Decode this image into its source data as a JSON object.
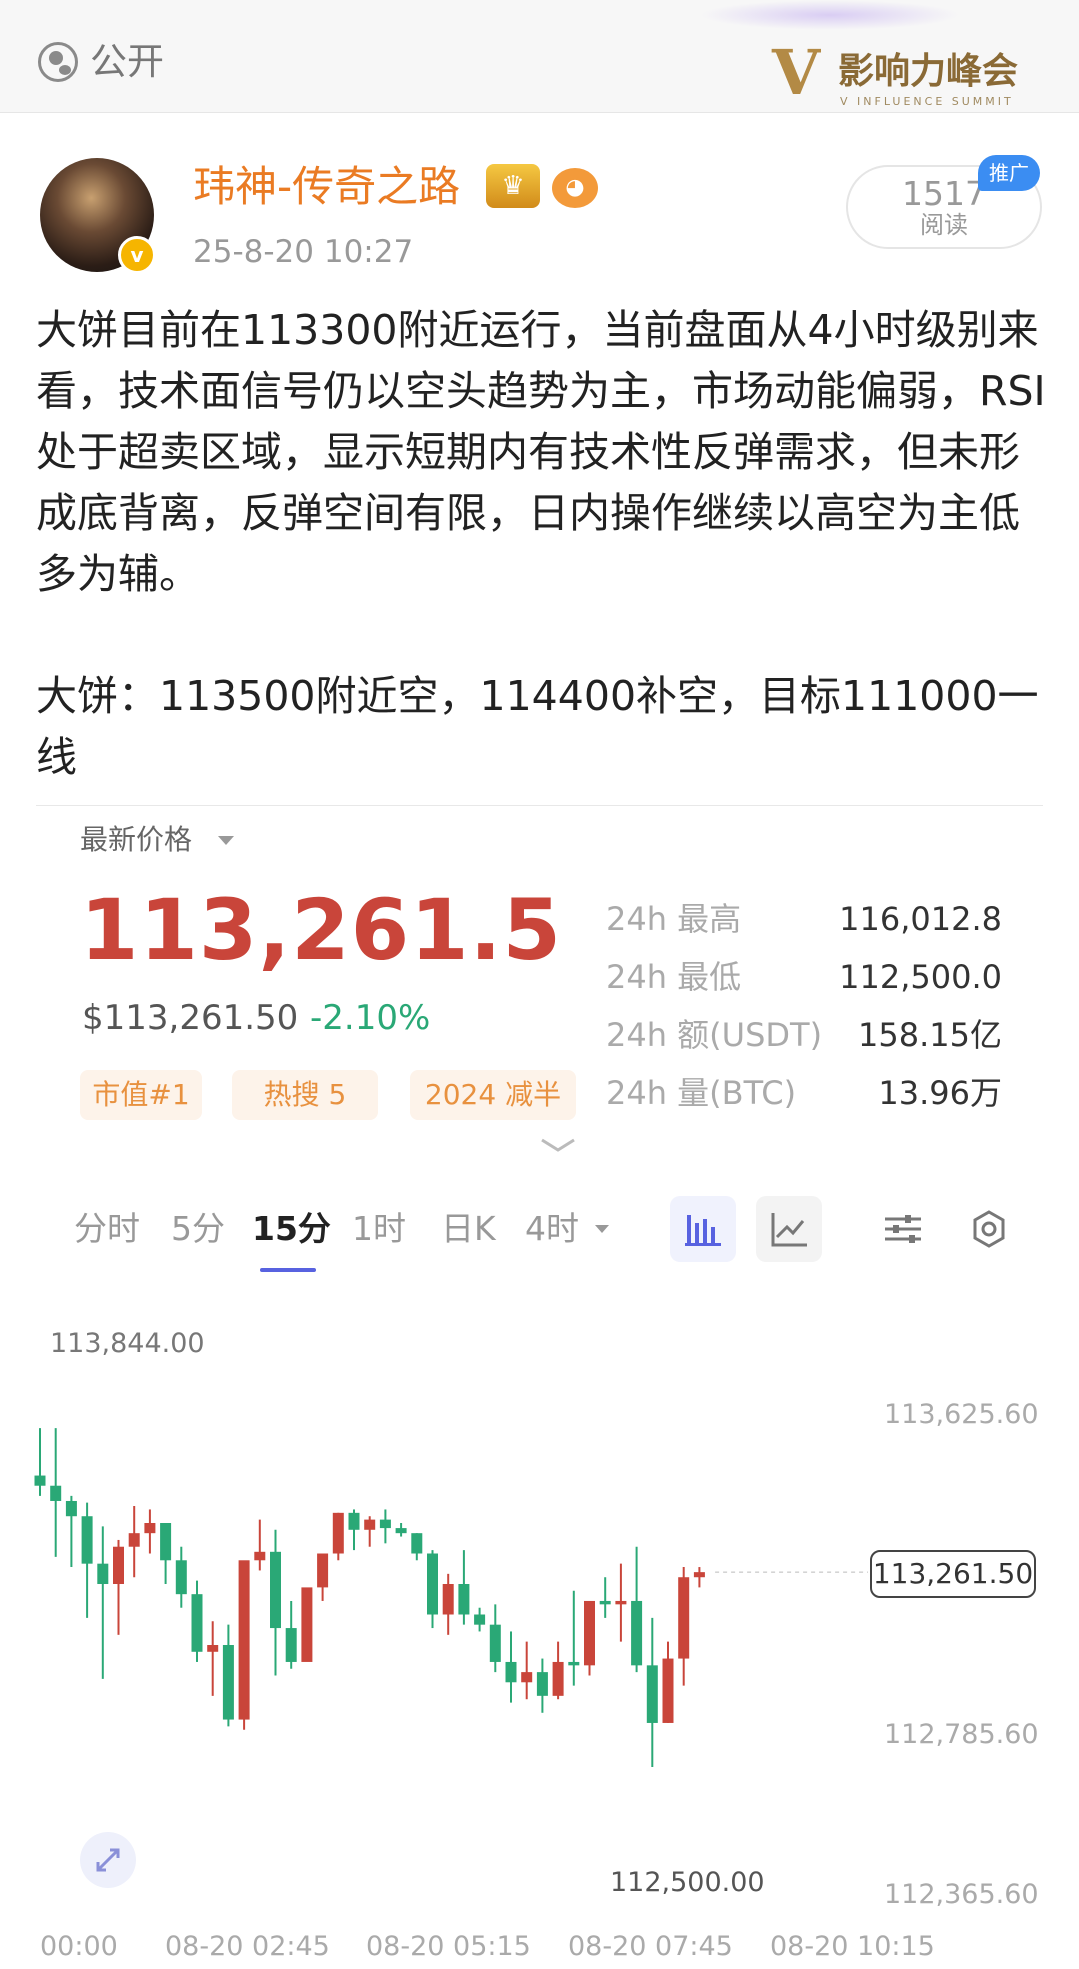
{
  "header": {
    "visibility_label": "公开",
    "banner_logo_mark": "V",
    "banner_logo_text": "影响力峰会",
    "banner_logo_sub": "V INFLUENCE SUMMIT"
  },
  "post": {
    "author": "玮神-传奇之路",
    "time": "25-8-20 10:27",
    "reads_count": "1517",
    "reads_label": "阅读",
    "promo_badge": "推广",
    "verified_mark": "v",
    "body": "大饼目前在113300附近运行，当前盘面从4小时级别来看，技术面信号仍以空头趋势为主，市场动能偏弱，RSI处于超卖区域，显示短期内有技术性反弹需求，但未形成底背离，反弹空间有限，日内操作继续以高空为主低多为辅。\n\n大饼：113500附近空，114400补空，目标111000一线"
  },
  "ticker": {
    "latest_label": "最新价格",
    "price": "113,261.5",
    "usd_price": "$113,261.50",
    "change_pct": "-2.10%",
    "tags": [
      "市值#1",
      "热搜 5",
      "2024 减半"
    ],
    "stats": [
      {
        "label": "24h 最高",
        "value": "116,012.8"
      },
      {
        "label": "24h 最低",
        "value": "112,500.0"
      },
      {
        "label": "24h 额(USDT)",
        "value": "158.15亿"
      },
      {
        "label": "24h 量(BTC)",
        "value": "13.96万"
      }
    ],
    "colors": {
      "up": "#c9453a",
      "down": "#2aa876",
      "active_tab": "#5862e0"
    }
  },
  "tabs": {
    "items": [
      "分时",
      "5分",
      "15分",
      "1时",
      "日K",
      "4时"
    ],
    "active": "15分",
    "tool_icons": [
      "bar-chart-icon",
      "line-chart-icon",
      "indicator-settings-icon",
      "gear-icon"
    ]
  },
  "chart_data": {
    "type": "candlestick",
    "interval": "15分",
    "y_axis_labels": [
      "113,625.60",
      "112,785.60",
      "112,365.60"
    ],
    "high_label": "113,844.00",
    "low_label": "112,500.00",
    "last_price_label": "113,261.50",
    "x_axis_labels": [
      "00:00",
      "08-20 02:45",
      "08-20 05:15",
      "08-20 07:45",
      "08-20 10:15"
    ],
    "ylim": [
      112365.6,
      113900
    ],
    "candles": [
      {
        "o": 113500,
        "h": 113640,
        "l": 113440,
        "c": 113470
      },
      {
        "o": 113470,
        "h": 113640,
        "l": 113260,
        "c": 113425
      },
      {
        "o": 113425,
        "h": 113440,
        "l": 113230,
        "c": 113380
      },
      {
        "o": 113380,
        "h": 113420,
        "l": 113080,
        "c": 113240
      },
      {
        "o": 113240,
        "h": 113350,
        "l": 112900,
        "c": 113180
      },
      {
        "o": 113180,
        "h": 113310,
        "l": 113030,
        "c": 113290
      },
      {
        "o": 113290,
        "h": 113410,
        "l": 113200,
        "c": 113330
      },
      {
        "o": 113330,
        "h": 113400,
        "l": 113270,
        "c": 113360
      },
      {
        "o": 113360,
        "h": 113360,
        "l": 113180,
        "c": 113250
      },
      {
        "o": 113250,
        "h": 113290,
        "l": 113110,
        "c": 113150
      },
      {
        "o": 113150,
        "h": 113190,
        "l": 112950,
        "c": 112980
      },
      {
        "o": 112980,
        "h": 113070,
        "l": 112850,
        "c": 113000
      },
      {
        "o": 113000,
        "h": 113060,
        "l": 112760,
        "c": 112780
      },
      {
        "o": 112780,
        "h": 113240,
        "l": 112750,
        "c": 113250
      },
      {
        "o": 113250,
        "h": 113370,
        "l": 113220,
        "c": 113275
      },
      {
        "o": 113275,
        "h": 113340,
        "l": 112910,
        "c": 113050
      },
      {
        "o": 113050,
        "h": 113130,
        "l": 112930,
        "c": 112950
      },
      {
        "o": 112950,
        "h": 113070,
        "l": 112960,
        "c": 113170
      },
      {
        "o": 113170,
        "h": 113270,
        "l": 113130,
        "c": 113270
      },
      {
        "o": 113270,
        "h": 113390,
        "l": 113250,
        "c": 113390
      },
      {
        "o": 113390,
        "h": 113400,
        "l": 113280,
        "c": 113340
      },
      {
        "o": 113340,
        "h": 113380,
        "l": 113290,
        "c": 113370
      },
      {
        "o": 113370,
        "h": 113400,
        "l": 113300,
        "c": 113345
      },
      {
        "o": 113345,
        "h": 113360,
        "l": 113320,
        "c": 113330
      },
      {
        "o": 113330,
        "h": 113330,
        "l": 113250,
        "c": 113270
      },
      {
        "o": 113270,
        "h": 113280,
        "l": 113050,
        "c": 113090
      },
      {
        "o": 113090,
        "h": 113210,
        "l": 113030,
        "c": 113180
      },
      {
        "o": 113180,
        "h": 113280,
        "l": 113060,
        "c": 113090
      },
      {
        "o": 113090,
        "h": 113110,
        "l": 113040,
        "c": 113060
      },
      {
        "o": 113060,
        "h": 113120,
        "l": 112920,
        "c": 112950
      },
      {
        "o": 112950,
        "h": 113040,
        "l": 112830,
        "c": 112890
      },
      {
        "o": 112890,
        "h": 113010,
        "l": 112840,
        "c": 112920
      },
      {
        "o": 112920,
        "h": 112960,
        "l": 112800,
        "c": 112850
      },
      {
        "o": 112850,
        "h": 113010,
        "l": 112840,
        "c": 112950
      },
      {
        "o": 112950,
        "h": 113160,
        "l": 112880,
        "c": 112940
      },
      {
        "o": 112940,
        "h": 113080,
        "l": 112910,
        "c": 113130
      },
      {
        "o": 113130,
        "h": 113200,
        "l": 113080,
        "c": 113120
      },
      {
        "o": 113120,
        "h": 113240,
        "l": 113010,
        "c": 113130
      },
      {
        "o": 113130,
        "h": 113290,
        "l": 112920,
        "c": 112940
      },
      {
        "o": 112940,
        "h": 113080,
        "l": 112640,
        "c": 112770
      },
      {
        "o": 112770,
        "h": 113010,
        "l": 112770,
        "c": 112960
      },
      {
        "o": 112960,
        "h": 113230,
        "l": 112880,
        "c": 113200
      },
      {
        "o": 113200,
        "h": 113230,
        "l": 113170,
        "c": 113215
      }
    ]
  }
}
